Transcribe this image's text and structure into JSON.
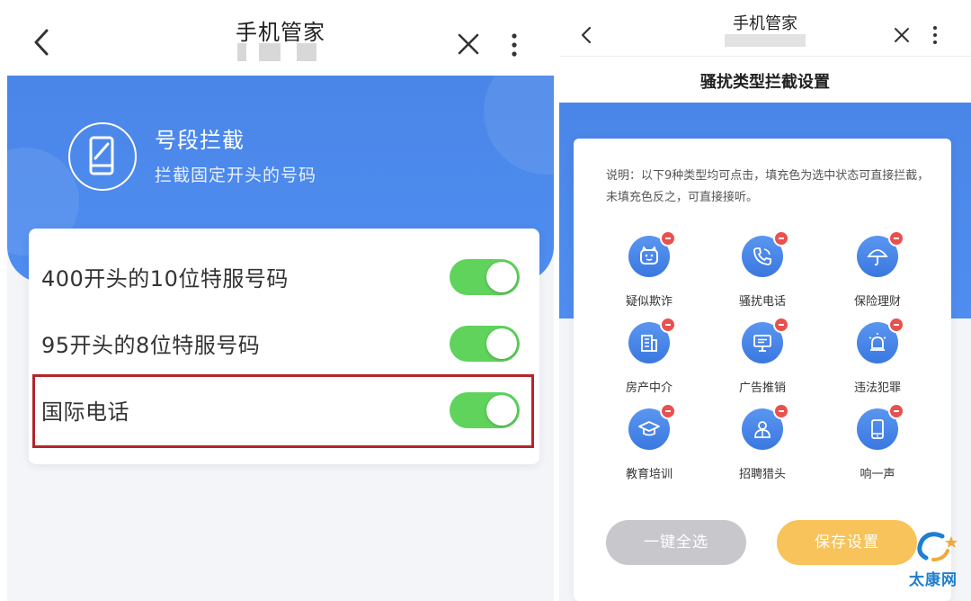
{
  "left": {
    "nav": {
      "title": "手机管家"
    },
    "hero": {
      "title": "号段拦截",
      "subtitle": "拦截固定开头的号码"
    },
    "rows": [
      {
        "label": "400开头的10位特服号码",
        "enabled": true
      },
      {
        "label": "95开头的8位特服号码",
        "enabled": true
      },
      {
        "label": "国际电话",
        "enabled": true,
        "highlighted": true
      }
    ],
    "colors": {
      "accent": "#4a86e8",
      "toggle_on": "#5fd35c",
      "highlight": "#b3262a"
    }
  },
  "right": {
    "nav": {
      "title": "手机管家"
    },
    "header": {
      "title": "骚扰类型拦截设置"
    },
    "note": "说明：以下9种类型均可点击，填充色为选中状态可直接拦截，未填充色反之，可直接接听。",
    "categories": [
      {
        "label": "疑似欺诈",
        "icon": "smiley-face-icon"
      },
      {
        "label": "骚扰电话",
        "icon": "phone-call-icon"
      },
      {
        "label": "保险理财",
        "icon": "umbrella-icon"
      },
      {
        "label": "房产中介",
        "icon": "building-icon"
      },
      {
        "label": "广告推销",
        "icon": "ad-board-icon"
      },
      {
        "label": "违法犯罪",
        "icon": "alarm-siren-icon"
      },
      {
        "label": "教育培训",
        "icon": "graduation-cap-icon"
      },
      {
        "label": "招聘猎头",
        "icon": "person-icon"
      },
      {
        "label": "响一声",
        "icon": "phone-device-icon"
      }
    ],
    "buttons": {
      "select_all": "一键全选",
      "save": "保存设置"
    },
    "colors": {
      "icon_blue": "#3a78e0",
      "badge_red": "#e8514e",
      "save": "#f7c35a",
      "disabled": "#c8c8cc"
    }
  },
  "watermark": {
    "text": "太康网"
  }
}
